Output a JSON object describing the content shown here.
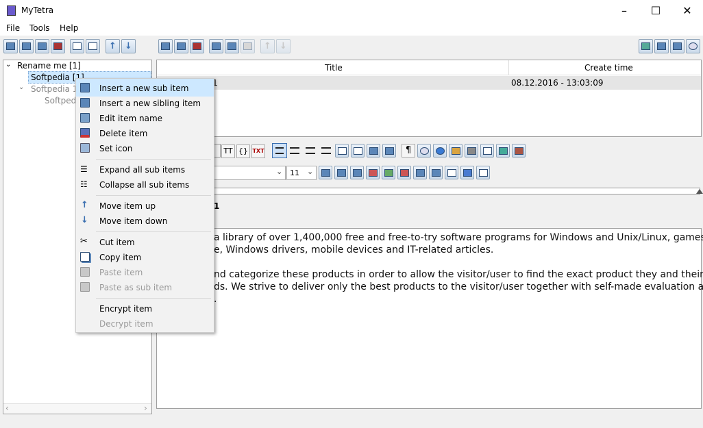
{
  "window": {
    "title": "MyTetra",
    "minimize": "–",
    "maximize": "☐",
    "close": "✕"
  },
  "menubar": {
    "items": [
      "File",
      "Tools",
      "Help"
    ]
  },
  "tree": {
    "items": [
      "Rename me [1]",
      "Softpedia [1]",
      "Softpedia 1",
      "Softpedia"
    ],
    "scroll_left": "‹",
    "scroll_right": "›"
  },
  "table": {
    "columns": [
      "Title",
      "Create time"
    ],
    "rows": [
      {
        "title": "1",
        "create_time": "08.12.2016 - 13:03:09"
      }
    ]
  },
  "format_toolbar": {
    "font_size": "11",
    "tt_label": "TT",
    "braces_label": "{}",
    "txt_label": "TXT",
    "pilcrow_label": "¶"
  },
  "record": {
    "title_fragment": "1"
  },
  "editor": {
    "lines": [
      "a library of over 1,400,000 free and free-to-try software programs for Windows and Unix/Linux, games,",
      "e, Windows drivers, mobile devices and IT-related articles.",
      "nd categorize these products in order to allow the visitor/user to find the exact product they and their",
      "ds. We strive to deliver only the best products to the visitor/user together with self-made evaluation and",
      "."
    ]
  },
  "context_menu": {
    "items": [
      {
        "label": "Insert a new sub item",
        "enabled": true,
        "icon": "insert-sub-icon"
      },
      {
        "label": "Insert a new sibling item",
        "enabled": true,
        "icon": "insert-sibling-icon"
      },
      {
        "label": "Edit item name",
        "enabled": true,
        "icon": "edit-icon"
      },
      {
        "label": "Delete item",
        "enabled": true,
        "icon": "delete-icon"
      },
      {
        "label": "Set icon",
        "enabled": true,
        "icon": "image-icon"
      },
      {
        "label": "Expand all sub items",
        "enabled": true,
        "icon": "expand-icon"
      },
      {
        "label": "Collapse all sub items",
        "enabled": true,
        "icon": "collapse-icon"
      },
      {
        "label": "Move item up",
        "enabled": true,
        "icon": "arrow-up-icon"
      },
      {
        "label": "Move item down",
        "enabled": true,
        "icon": "arrow-down-icon"
      },
      {
        "label": "Cut item",
        "enabled": true,
        "icon": "cut-icon"
      },
      {
        "label": "Copy item",
        "enabled": true,
        "icon": "copy-icon"
      },
      {
        "label": "Paste item",
        "enabled": false,
        "icon": "paste-icon"
      },
      {
        "label": "Paste as sub item",
        "enabled": false,
        "icon": "paste-sub-icon"
      },
      {
        "label": "Encrypt item",
        "enabled": true,
        "icon": ""
      },
      {
        "label": "Decrypt item",
        "enabled": false,
        "icon": ""
      }
    ]
  }
}
